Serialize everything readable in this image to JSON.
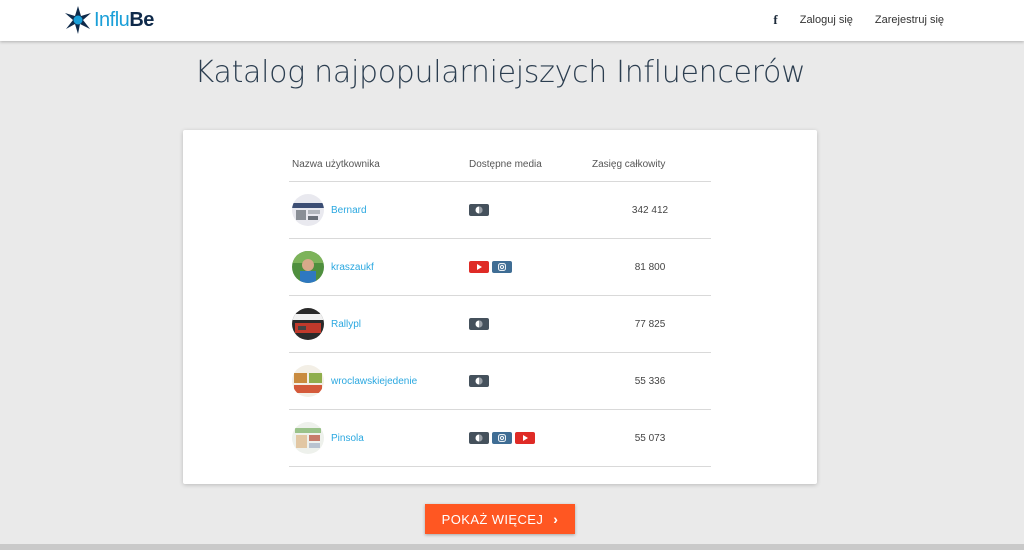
{
  "brand": {
    "logo_part1": "Influ",
    "logo_part2": "Be",
    "colors": {
      "primary": "#1a9fd8",
      "dark": "#0f2a4a"
    }
  },
  "nav": {
    "facebook_icon": "f",
    "login": "Zaloguj się",
    "register": "Zarejestruj się"
  },
  "page": {
    "title": "Katalog najpopularniejszych Influencerów"
  },
  "table": {
    "headers": {
      "user": "Nazwa użytkownika",
      "media": "Dostępne media",
      "reach": "Zasięg całkowity"
    },
    "rows": [
      {
        "username": "Bernard",
        "media": [
          "web"
        ],
        "reach": "342 412"
      },
      {
        "username": "kraszaukf",
        "media": [
          "youtube",
          "instagram"
        ],
        "reach": "81 800"
      },
      {
        "username": "Rallypl",
        "media": [
          "web"
        ],
        "reach": "77 825"
      },
      {
        "username": "wroclawskiejedenie",
        "media": [
          "web"
        ],
        "reach": "55 336"
      },
      {
        "username": "Pinsola",
        "media": [
          "web",
          "instagram",
          "youtube"
        ],
        "reach": "55 073"
      }
    ]
  },
  "show_more": {
    "label": "POKAŻ WIĘCEJ",
    "color": "#ff5722"
  }
}
